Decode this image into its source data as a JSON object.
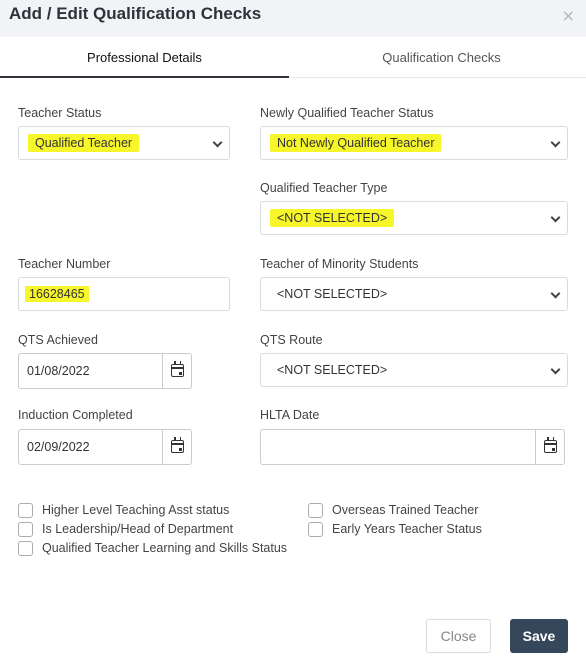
{
  "dialog": {
    "title": "Add / Edit Qualification Checks",
    "close_icon": "×"
  },
  "tabs": [
    {
      "label": "Professional Details",
      "active": true
    },
    {
      "label": "Qualification Checks",
      "active": false
    }
  ],
  "fields": {
    "teacher_status": {
      "label": "Teacher Status",
      "value": "Qualified Teacher"
    },
    "nqt_status": {
      "label": "Newly Qualified Teacher Status",
      "value": "Not Newly Qualified Teacher"
    },
    "qualified_teacher_type": {
      "label": "Qualified Teacher Type",
      "value": "<NOT SELECTED>"
    },
    "teacher_number": {
      "label": "Teacher Number",
      "value": "16628465"
    },
    "minority_students": {
      "label": "Teacher of Minority Students",
      "value": "<NOT SELECTED>"
    },
    "qts_achieved": {
      "label": "QTS Achieved",
      "value": "01/08/2022"
    },
    "qts_route": {
      "label": "QTS Route",
      "value": "<NOT SELECTED>"
    },
    "induction_completed": {
      "label": "Induction Completed",
      "value": "02/09/2022"
    },
    "hlta_date": {
      "label": "HLTA Date",
      "value": ""
    }
  },
  "checkboxes": [
    {
      "label": "Higher Level Teaching Asst status",
      "checked": false
    },
    {
      "label": "Is Leadership/Head of Department",
      "checked": false
    },
    {
      "label": "Qualified Teacher Learning and Skills Status",
      "checked": false
    },
    {
      "label": "Overseas Trained Teacher",
      "checked": false
    },
    {
      "label": "Early Years Teacher Status",
      "checked": false
    }
  ],
  "buttons": {
    "close": "Close",
    "save": "Save"
  },
  "colors": {
    "highlight": "#f6f62a",
    "save_button": "#34475b",
    "header_bg": "#f1f3f6"
  }
}
